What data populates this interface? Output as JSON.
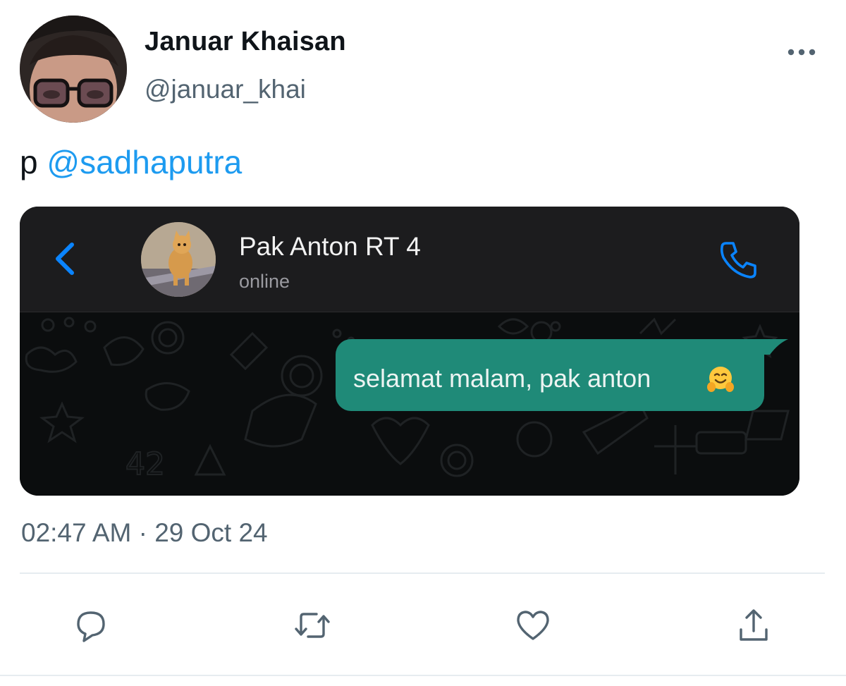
{
  "tweet": {
    "author_name": "Januar Khaisan",
    "author_handle": "@januar_khai",
    "text_prefix": "p",
    "mention": "@sadhaputra",
    "timestamp": "02:47 AM · 29 Oct 24"
  },
  "chat_screenshot": {
    "contact_name": "Pak Anton RT 4",
    "contact_status": "online",
    "message": "selamat malam, pak anton",
    "message_emoji": "hugging-face",
    "colors": {
      "bubble": "#1f8a78",
      "accent": "#0a84ff",
      "header": "#1c1c1e",
      "background": "#0b0d0e"
    }
  },
  "actions": {
    "icons": [
      "reply-icon",
      "retweet-icon",
      "like-icon",
      "share-icon"
    ]
  },
  "colors": {
    "mention": "#1d9bf0",
    "secondary_text": "#536471",
    "action_icons": "#536471"
  }
}
